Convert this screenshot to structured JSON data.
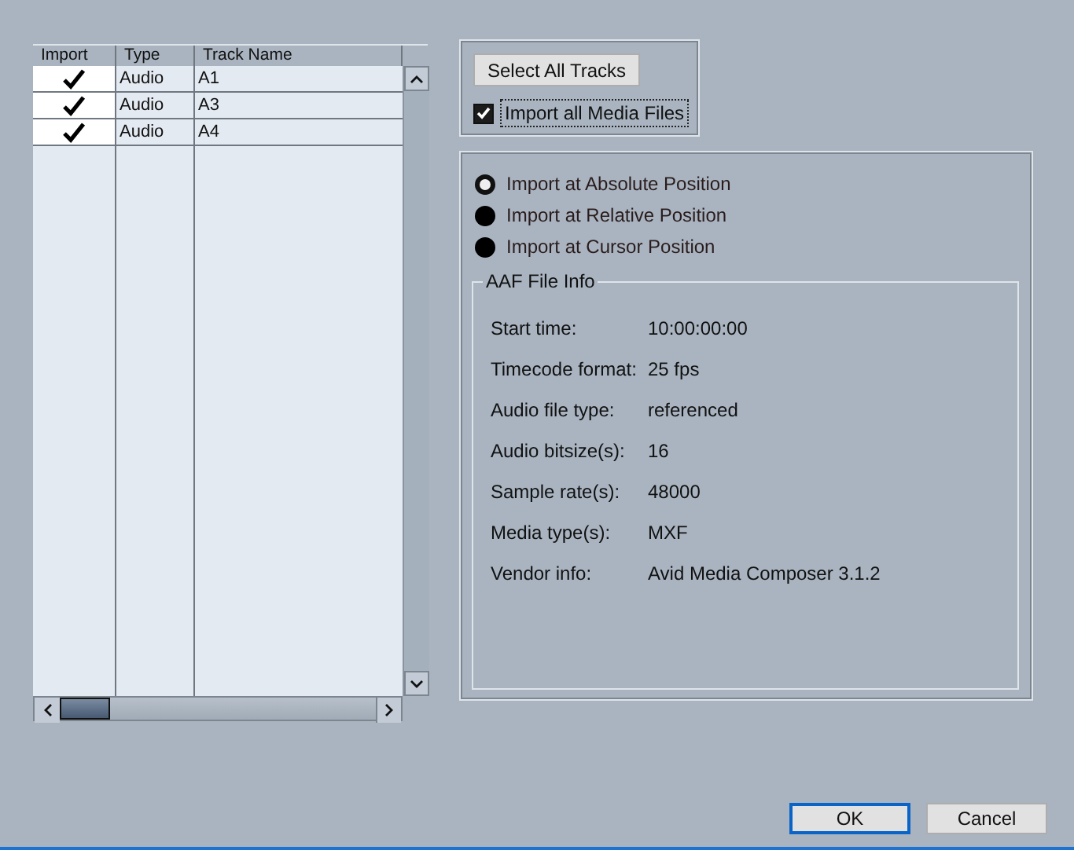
{
  "tracks": {
    "columns": [
      "Import",
      "Type",
      "Track Name"
    ],
    "rows": [
      {
        "import": true,
        "type": "Audio",
        "name": "A1"
      },
      {
        "import": true,
        "type": "Audio",
        "name": "A3"
      },
      {
        "import": true,
        "type": "Audio",
        "name": "A4"
      }
    ]
  },
  "select_all_button": "Select All Tracks",
  "import_media": {
    "label": "Import all Media Files",
    "checked": true
  },
  "positions": [
    {
      "label": "Import at Absolute Position",
      "selected": true
    },
    {
      "label": "Import at Relative Position",
      "selected": false
    },
    {
      "label": "Import at Cursor Position",
      "selected": false
    }
  ],
  "file_info": {
    "title": "AAF File Info",
    "rows": [
      {
        "label": "Start time:",
        "value": "10:00:00:00"
      },
      {
        "label": "Timecode format:",
        "value": "25 fps"
      },
      {
        "label": "Audio file type:",
        "value": "referenced"
      },
      {
        "label": "Audio bitsize(s):",
        "value": "16"
      },
      {
        "label": "Sample rate(s):",
        "value": "48000"
      },
      {
        "label": "Media type(s):",
        "value": "MXF"
      },
      {
        "label": "Vendor info:",
        "value": "Avid Media Composer 3.1.2"
      }
    ]
  },
  "buttons": [
    "OK",
    "Cancel"
  ]
}
